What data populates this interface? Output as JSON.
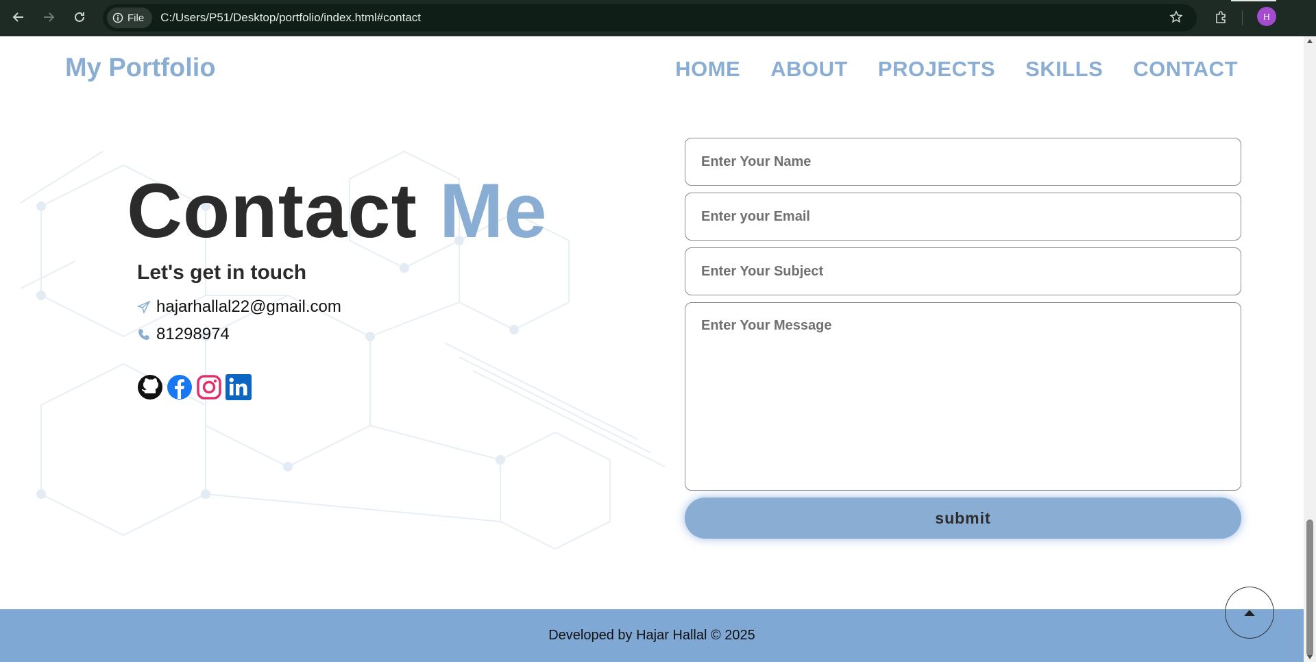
{
  "browser": {
    "file_chip": "File",
    "url": "C:/Users/P51/Desktop/portfolio/index.html#contact",
    "avatar_letter": "H"
  },
  "header": {
    "logo": "My Portfolio",
    "nav": [
      "HOME",
      "ABOUT",
      "PROJECTS",
      "SKILLS",
      "CONTACT"
    ]
  },
  "contact": {
    "heading_main": "Contact",
    "heading_accent": "Me",
    "subheading": "Let's get in touch",
    "email": "hajarhallal22@gmail.com",
    "phone": "81298974",
    "socials": [
      "github-icon",
      "facebook-icon",
      "instagram-icon",
      "linkedin-icon"
    ]
  },
  "form": {
    "name_placeholder": "Enter Your Name",
    "email_placeholder": "Enter your Email",
    "subject_placeholder": "Enter Your Subject",
    "message_placeholder": "Enter Your Message",
    "submit_label": "submit"
  },
  "footer": {
    "text": "Developed by Hajar Hallal © 2025"
  },
  "colors": {
    "accent": "#8aaed3",
    "footer": "#7fa8d4",
    "heading": "#2b2b2b",
    "browser_bar": "#1e2b24"
  }
}
